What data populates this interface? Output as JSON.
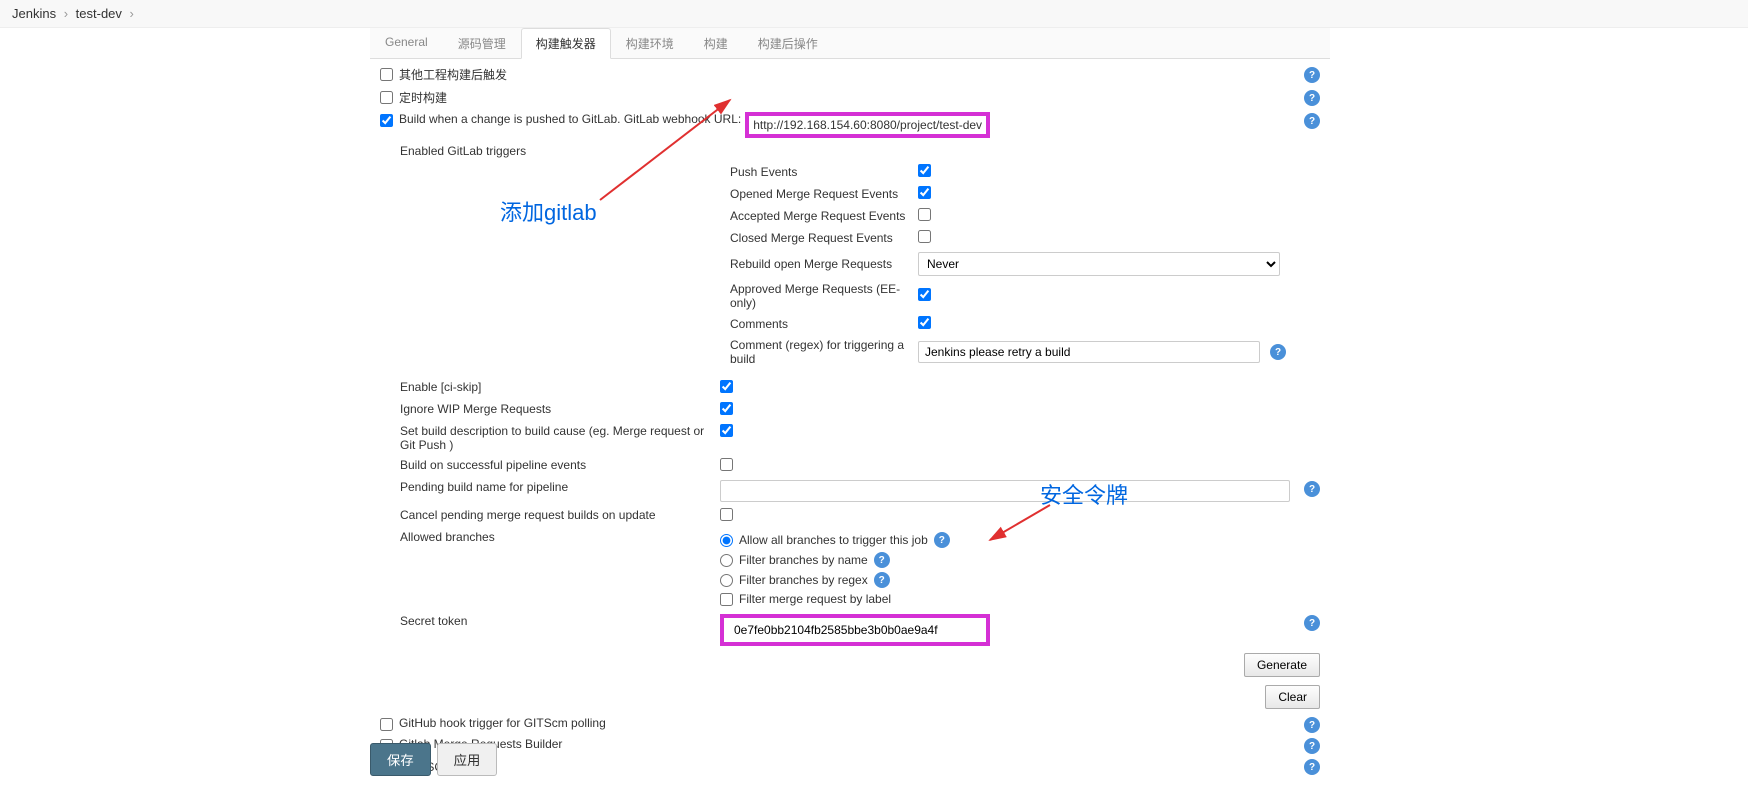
{
  "breadcrumb": {
    "root": "Jenkins",
    "project": "test-dev"
  },
  "tabs": {
    "general": "General",
    "scm": "源码管理",
    "triggers": "构建触发器",
    "env": "构建环境",
    "build": "构建",
    "post": "构建后操作"
  },
  "rows": {
    "other_remote": "其他工程构建后触发",
    "cron": "定时构建",
    "gitlab_push": "Build when a change is pushed to GitLab. GitLab webhook URL:",
    "gitlab_url": "http://192.168.154.60:8080/project/test-dev",
    "enabled_triggers": "Enabled GitLab triggers",
    "github_hook": "GitHub hook trigger for GITScm polling",
    "gitlab_mr_builder": "Gitlab Merge Requests Builder",
    "poll_scm": "轮询 SCM"
  },
  "triggers": {
    "push": "Push Events",
    "opened_mr": "Opened Merge Request Events",
    "accepted_mr": "Accepted Merge Request Events",
    "closed_mr": "Closed Merge Request Events",
    "rebuild": "Rebuild open Merge Requests",
    "rebuild_value": "Never",
    "approved": "Approved Merge Requests (EE-only)",
    "comments": "Comments",
    "comment_regex": "Comment (regex) for triggering a build",
    "comment_regex_value": "Jenkins please retry a build"
  },
  "opts": {
    "ci_skip": "Enable [ci-skip]",
    "ignore_wip": "Ignore WIP Merge Requests",
    "build_desc": "Set build description to build cause (eg. Merge request or Git Push )",
    "pipeline_events": "Build on successful pipeline events",
    "pending_name": "Pending build name for pipeline",
    "cancel_pending": "Cancel pending merge request builds on update",
    "allowed_branches": "Allowed branches",
    "secret_token": "Secret token",
    "secret_value": "0e7fe0bb2104fb2585bbe3b0b0ae9a4f"
  },
  "branches": {
    "allow_all": "Allow all branches to trigger this job",
    "by_name": "Filter branches by name",
    "by_regex": "Filter branches by regex",
    "by_label": "Filter merge request by label"
  },
  "buttons": {
    "generate": "Generate",
    "clear": "Clear",
    "save": "保存",
    "apply": "应用"
  },
  "annotations": {
    "add_gitlab": "添加gitlab",
    "security_token": "安全令牌"
  }
}
